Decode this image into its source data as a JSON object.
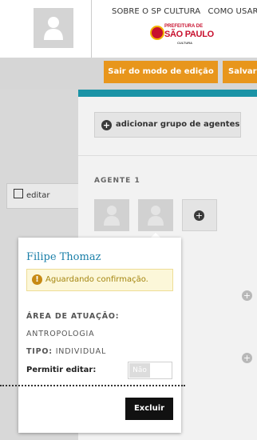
{
  "header": {
    "nav": [
      "SOBRE O SP CULTURA",
      "COMO USAR"
    ],
    "logo": {
      "line1": "PREFEITURA DE",
      "line2": "SÃO PAULO",
      "line3": "CULTURA"
    }
  },
  "editbar": {
    "exit_edit_label": "Sair do modo de edição",
    "save_label": "Salvar"
  },
  "left": {
    "edit_label": "editar"
  },
  "content": {
    "add_group_label": "adicionar grupo de agentes",
    "group_label": "AGENTE 1"
  },
  "popover": {
    "name": "Filipe Thomaz",
    "alert": "Aguardando confirmação.",
    "area_label": "ÁREA DE ATUAÇÃO:",
    "area_value": "ANTROPOLOGIA",
    "tipo_label": "TIPO:",
    "tipo_value": "INDIVIDUAL",
    "permitir_label": "Permitir editar:",
    "toggle_value": "Não",
    "delete_label": "Excluir"
  },
  "colors": {
    "accent_orange": "#e8961c",
    "teal": "#1a93a6",
    "link_blue": "#1a7fa8",
    "alert_bg": "#fcf7d9"
  },
  "icons": [
    "user-avatar-icon",
    "plus-circle-icon",
    "warning-icon",
    "edit-icon"
  ]
}
